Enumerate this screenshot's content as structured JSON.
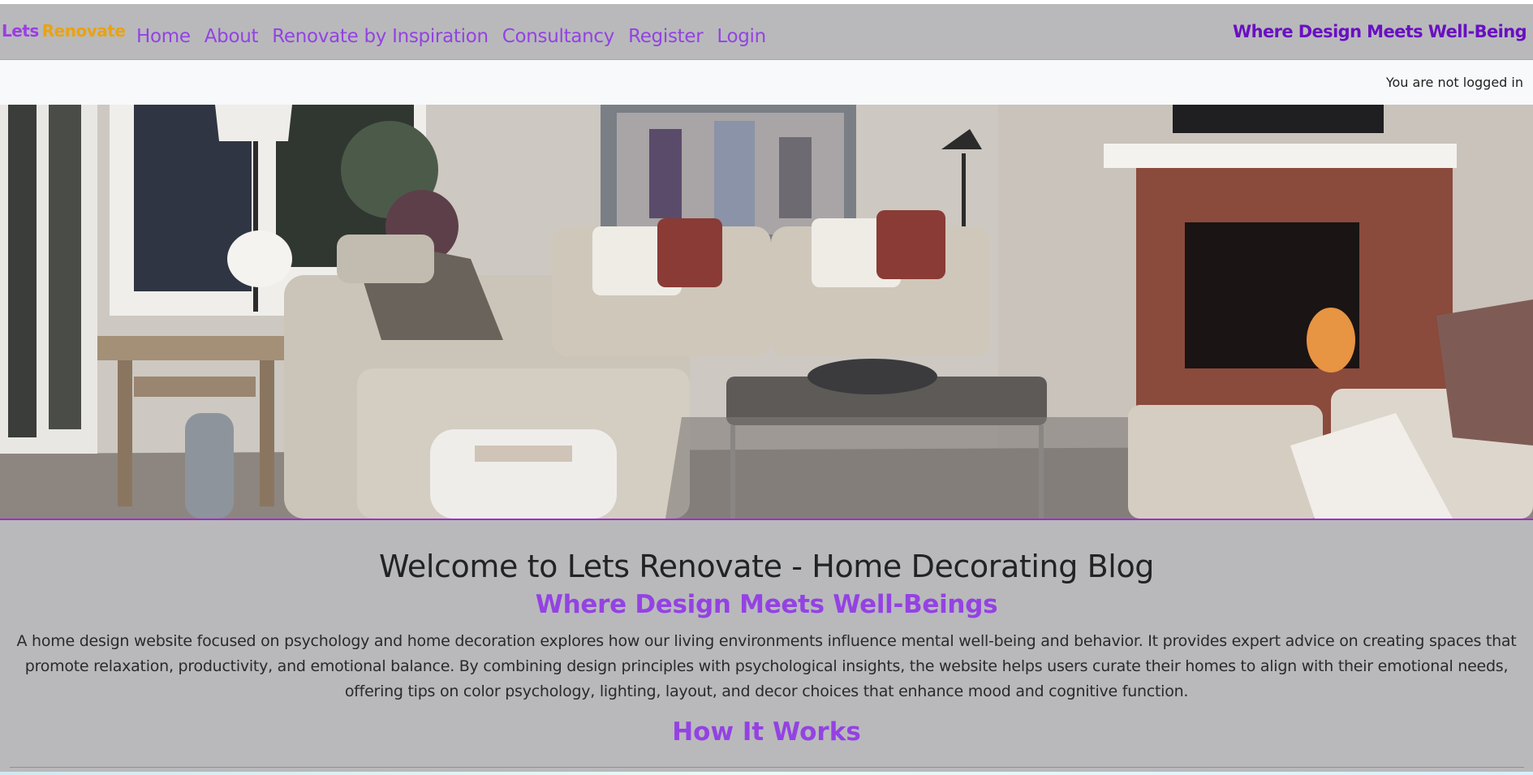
{
  "navbar": {
    "brand_part1": "Lets",
    "brand_part2": "Renovate",
    "links": [
      "Home",
      "About",
      "Renovate by Inspiration",
      "Consultancy",
      "Register",
      "Login"
    ],
    "tagline": "Where Design Meets Well-Being"
  },
  "status": {
    "login_text": "You are not logged in"
  },
  "hero": {
    "image": "living-room-photo"
  },
  "main": {
    "title": "Welcome to Lets Renovate - Home Decorating Blog",
    "subtitle": "Where Design Meets Well-Beings",
    "description": "A home design website focused on psychology and home decoration explores how our living environments influence mental well-being and behavior. It provides expert advice on creating spaces that promote relaxation, productivity, and emotional balance. By combining design principles with psychological insights, the website helps users curate their homes to align with their emotional needs, offering tips on color psychology, lighting, layout, and decor choices that enhance mood and cognitive function.",
    "how_heading": "How It Works"
  },
  "colors": {
    "accent_purple": "#9442e3",
    "brand_orange": "#e9a310",
    "tagline_purple": "#6a0fc1",
    "background_gray": "#b9b9bc"
  }
}
